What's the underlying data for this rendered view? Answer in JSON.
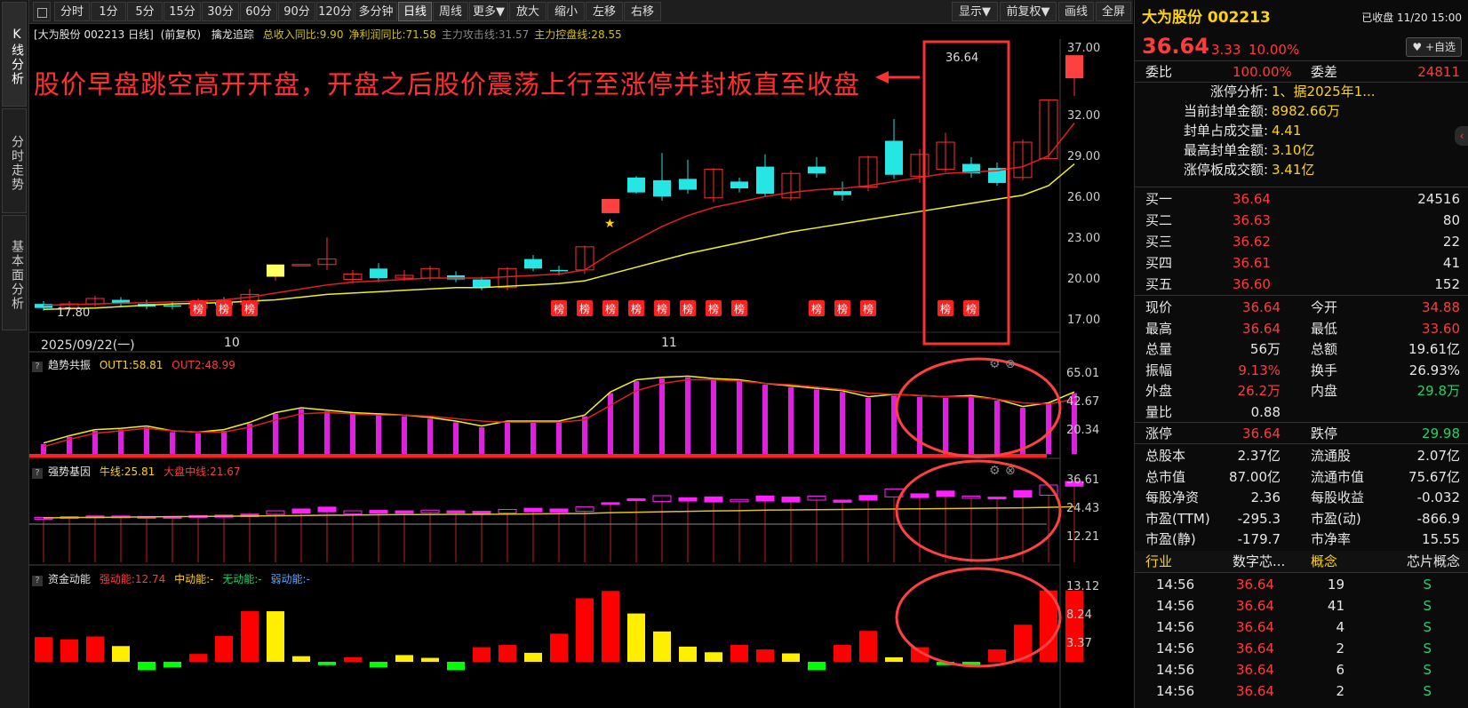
{
  "sidebar": {
    "tabs": [
      {
        "label": "K线分析",
        "active": true
      },
      {
        "label": "分时走势",
        "active": false
      },
      {
        "label": "基本面分析",
        "active": false
      }
    ]
  },
  "toolbar": {
    "lock_icon": "square-icon",
    "buttons": [
      "分时",
      "1分",
      "5分",
      "15分",
      "30分",
      "60分",
      "90分",
      "120分",
      "多分钟",
      "日线",
      "周线",
      "更多▼",
      "放大",
      "缩小",
      "左移",
      "右移"
    ],
    "active": "日线",
    "right_buttons": [
      "显示▼",
      "前复权▼",
      "画线",
      "全屏"
    ]
  },
  "chart_header": {
    "stock": "[大为股份 002213 日线]",
    "adjust": "(前复权)",
    "indicator": "擒龙追踪",
    "items": [
      {
        "text": "总收入同比:9.90",
        "color": "#d6c400"
      },
      {
        "text": "净利润同比:71.58",
        "color": "#d6c400"
      },
      {
        "text": "主力攻击线:31.57",
        "color": "#888888"
      },
      {
        "text": "主力控盘线:28.55",
        "color": "#d6c400"
      }
    ]
  },
  "annotation": "股价早盘跳空高开开盘，开盘之后股价震荡上行至涨停并封板直至收盘",
  "main_axis": [
    "37.00",
    "32.00",
    "29.00",
    "26.00",
    "23.00",
    "20.00",
    "17.00"
  ],
  "date_labels": {
    "start": "2025/09/22(一)",
    "m1": "10",
    "m2": "11"
  },
  "price_marks": {
    "high": "36.64",
    "low": "17.80"
  },
  "badge_text": "榜",
  "panels": {
    "p1": {
      "title": "趋势共振",
      "out1": "OUT1:58.81",
      "out2": "OUT2:48.99",
      "axis": [
        "65.01",
        "42.67",
        "20.34"
      ]
    },
    "p2": {
      "title": "强势基因",
      "l1": "牛线:25.81",
      "l2": "大盘中线:21.67",
      "axis": [
        "36.61",
        "24.43",
        "12.21"
      ]
    },
    "p3": {
      "title": "资金动能",
      "l1": "强动能:12.74",
      "l2": "中动能:-",
      "l3": "无动能:-",
      "l4": "弱动能:-",
      "axis": [
        "13.12",
        "8.24",
        "3.37"
      ]
    }
  },
  "chart_data": {
    "type": "candlestick",
    "candles": [
      [
        18.3,
        18.0,
        18.5,
        17.8
      ],
      [
        18.0,
        18.3,
        18.5,
        17.9
      ],
      [
        18.3,
        18.7,
        18.9,
        18.1
      ],
      [
        18.6,
        18.3,
        18.8,
        18.1
      ],
      [
        18.3,
        18.1,
        18.6,
        17.9
      ],
      [
        18.2,
        18.1,
        18.5,
        17.9
      ],
      [
        18.0,
        18.5,
        18.7,
        17.9
      ],
      [
        18.4,
        18.2,
        18.8,
        18.0
      ],
      [
        18.3,
        19.0,
        19.4,
        18.1
      ],
      [
        20.3,
        21.2,
        21.2,
        20.0
      ],
      [
        21.2,
        21.2,
        21.2,
        21.2
      ],
      [
        21.2,
        21.6,
        23.2,
        20.8
      ],
      [
        20.1,
        20.5,
        20.8,
        19.8
      ],
      [
        20.9,
        20.2,
        21.3,
        19.9
      ],
      [
        20.2,
        20.4,
        20.8,
        20.0
      ],
      [
        20.2,
        20.9,
        21.1,
        20.0
      ],
      [
        20.4,
        20.1,
        20.7,
        19.9
      ],
      [
        20.1,
        19.5,
        20.3,
        19.3
      ],
      [
        19.5,
        20.9,
        21.0,
        19.3
      ],
      [
        21.6,
        20.9,
        21.9,
        20.7
      ],
      [
        20.8,
        20.7,
        21.1,
        20.4
      ],
      [
        20.8,
        22.5,
        22.6,
        20.5
      ],
      [
        25.5,
        25.5,
        25.5,
        25.5
      ],
      [
        27.6,
        26.5,
        27.7,
        26.4
      ],
      [
        27.4,
        26.2,
        29.4,
        25.9
      ],
      [
        27.5,
        26.7,
        28.9,
        26.4
      ],
      [
        26.1,
        28.2,
        28.3,
        25.8
      ],
      [
        27.3,
        26.8,
        27.6,
        26.5
      ],
      [
        28.4,
        26.4,
        29.3,
        26.2
      ],
      [
        26.1,
        27.9,
        28.1,
        25.9
      ],
      [
        28.4,
        27.9,
        29.1,
        27.6
      ],
      [
        26.6,
        26.3,
        27.3,
        25.9
      ],
      [
        26.9,
        29.1,
        29.2,
        26.6
      ],
      [
        30.3,
        27.8,
        31.9,
        27.5
      ],
      [
        27.7,
        29.3,
        29.7,
        27.2
      ],
      [
        28.2,
        30.2,
        30.9,
        28.0
      ],
      [
        28.6,
        27.9,
        29.1,
        27.6
      ],
      [
        28.3,
        27.2,
        28.7,
        27.0
      ],
      [
        27.6,
        30.2,
        30.4,
        27.4
      ],
      [
        29.0,
        33.3,
        33.3,
        29.0
      ],
      [
        34.9,
        36.6,
        36.6,
        33.6
      ]
    ],
    "ma_red": [
      18.2,
      18.25,
      18.3,
      18.35,
      18.4,
      18.45,
      18.5,
      18.6,
      18.8,
      19.1,
      19.4,
      19.7,
      19.9,
      20.0,
      20.1,
      20.2,
      20.2,
      20.2,
      20.3,
      20.4,
      20.5,
      20.8,
      22.0,
      23.0,
      24.0,
      24.8,
      25.4,
      25.8,
      26.2,
      26.5,
      26.7,
      26.8,
      27.0,
      27.3,
      27.6,
      27.9,
      28.0,
      28.1,
      28.4,
      29.2,
      31.6
    ],
    "ma_yellow": [
      17.9,
      17.95,
      18.0,
      18.1,
      18.2,
      18.3,
      18.35,
      18.4,
      18.5,
      18.6,
      18.8,
      19.0,
      19.1,
      19.2,
      19.3,
      19.4,
      19.5,
      19.5,
      19.6,
      19.7,
      19.8,
      20.0,
      20.5,
      21.0,
      21.5,
      22.0,
      22.4,
      22.8,
      23.2,
      23.6,
      23.9,
      24.2,
      24.5,
      24.8,
      25.1,
      25.4,
      25.7,
      26.0,
      26.3,
      27.0,
      28.6
    ],
    "badges": [
      6,
      7,
      8,
      20,
      21,
      22,
      23,
      24,
      25,
      26,
      27,
      30,
      31,
      32,
      35,
      36
    ],
    "p1_values": [
      8,
      14,
      19,
      20,
      22,
      18,
      17,
      19,
      25,
      33,
      37,
      35,
      33,
      32,
      31,
      29,
      26,
      22,
      26,
      26,
      26,
      31,
      50,
      60,
      62,
      63,
      61,
      60,
      57,
      55,
      53,
      51,
      46,
      48,
      47,
      46,
      47,
      44,
      38,
      41,
      50,
      58
    ],
    "p1_red": [
      6,
      12,
      17,
      19,
      21,
      19,
      18,
      18,
      22,
      28,
      33,
      34,
      33,
      32,
      32,
      31,
      29,
      27,
      26,
      26,
      26,
      28,
      40,
      52,
      58,
      61,
      61,
      60,
      58,
      57,
      55,
      53,
      50,
      49,
      48,
      47,
      47,
      45,
      42,
      41,
      45,
      49
    ],
    "p2_values": [
      [
        20.5,
        21.2
      ],
      [
        20.8,
        21.5
      ],
      [
        21.0,
        21.8
      ],
      [
        21.1,
        21.8
      ],
      [
        21.0,
        21.6
      ],
      [
        20.9,
        21.6
      ],
      [
        21.2,
        22.0
      ],
      [
        21.3,
        22.2
      ],
      [
        21.5,
        22.6
      ],
      [
        22.5,
        24.0
      ],
      [
        23.0,
        24.8
      ],
      [
        23.6,
        25.6
      ],
      [
        22.8,
        24.0
      ],
      [
        23.0,
        24.2
      ],
      [
        23.0,
        24.0
      ],
      [
        23.2,
        24.3
      ],
      [
        23.1,
        24.0
      ],
      [
        22.6,
        23.8
      ],
      [
        23.0,
        24.6
      ],
      [
        23.6,
        25.1
      ],
      [
        23.5,
        24.8
      ],
      [
        23.8,
        25.7
      ],
      [
        27.5,
        27.5
      ],
      [
        28.4,
        29.2
      ],
      [
        28.0,
        30.5
      ],
      [
        28.2,
        29.6
      ],
      [
        27.8,
        30.0
      ],
      [
        27.9,
        28.9
      ],
      [
        28.2,
        30.4
      ],
      [
        27.8,
        29.9
      ],
      [
        28.6,
        30.3
      ],
      [
        27.7,
        28.6
      ],
      [
        28.6,
        30.6
      ],
      [
        30.0,
        33.4
      ],
      [
        29.7,
        31.3
      ],
      [
        30.2,
        32.5
      ],
      [
        29.4,
        30.3
      ],
      [
        29.2,
        29.9
      ],
      [
        29.9,
        32.7
      ],
      [
        30.7,
        35.1
      ],
      [
        34.6,
        36.6
      ]
    ],
    "p2_line": [
      21.0,
      21.1,
      21.2,
      21.3,
      21.4,
      21.5,
      21.6,
      21.7,
      21.8,
      21.9,
      22.0,
      22.1,
      22.2,
      22.3,
      22.4,
      22.4,
      22.5,
      22.5,
      22.6,
      22.7,
      22.8,
      22.9,
      23.2,
      23.4,
      23.6,
      23.8,
      24.0,
      24.1,
      24.3,
      24.4,
      24.5,
      24.6,
      24.7,
      24.8,
      24.9,
      25.0,
      25.1,
      25.2,
      25.3,
      25.5,
      25.8
    ],
    "p3_values": [
      [
        4.4,
        "#ff0000"
      ],
      [
        4.0,
        "#ff0000"
      ],
      [
        4.5,
        "#ff0000"
      ],
      [
        2.8,
        "#ffee00"
      ],
      [
        -1.5,
        "#00ff00"
      ],
      [
        -1.0,
        "#00ff00"
      ],
      [
        1.4,
        "#ff0000"
      ],
      [
        4.6,
        "#ff0000"
      ],
      [
        9.0,
        "#ff0000"
      ],
      [
        9.0,
        "#ffee00"
      ],
      [
        1.0,
        "#ffee00"
      ],
      [
        -0.6,
        "#00ff00"
      ],
      [
        0.8,
        "#ff0000"
      ],
      [
        -1.0,
        "#00ff00"
      ],
      [
        1.2,
        "#ffee00"
      ],
      [
        0.7,
        "#ffee00"
      ],
      [
        -1.5,
        "#00ff00"
      ],
      [
        2.6,
        "#ff0000"
      ],
      [
        3.0,
        "#ff0000"
      ],
      [
        1.6,
        "#ffee00"
      ],
      [
        5.0,
        "#ff0000"
      ],
      [
        11.3,
        "#ff0000"
      ],
      [
        12.6,
        "#ff0000"
      ],
      [
        8.6,
        "#ffee00"
      ],
      [
        5.4,
        "#ffee00"
      ],
      [
        2.7,
        "#ffee00"
      ],
      [
        1.7,
        "#ffee00"
      ],
      [
        3.0,
        "#ff0000"
      ],
      [
        2.2,
        "#ff0000"
      ],
      [
        1.5,
        "#ffee00"
      ],
      [
        -1.5,
        "#00ff00"
      ],
      [
        3.0,
        "#ff0000"
      ],
      [
        5.5,
        "#ff0000"
      ],
      [
        0.8,
        "#ffee00"
      ],
      [
        2.6,
        "#ff0000"
      ],
      [
        -0.6,
        "#00ff00"
      ],
      [
        -0.8,
        "#00ff00"
      ],
      [
        2.2,
        "#ff0000"
      ],
      [
        6.6,
        "#ff0000"
      ],
      [
        12.7,
        "#ff0000"
      ],
      [
        12.7,
        "#ff0000"
      ]
    ]
  },
  "right_panel": {
    "name": "大为股份 002213",
    "status": "已收盘 11/20 15:00",
    "price": "36.64",
    "change": "3.33",
    "pct": "10.00%",
    "fav_label": "+自选",
    "weibi_label": "委比",
    "weibi": "100.00%",
    "weicha_label": "委差",
    "weicha": "24811",
    "limit_analysis": [
      {
        "k": "涨停分析:",
        "v": "1、据2025年1..."
      },
      {
        "k": "当前封单金额:",
        "v": "8982.66万"
      },
      {
        "k": "封单占成交量:",
        "v": "4.41"
      },
      {
        "k": "最高封单金额:",
        "v": "3.10亿"
      },
      {
        "k": "涨停板成交额:",
        "v": "3.41亿"
      }
    ],
    "bids": [
      {
        "k": "买一",
        "p": "36.64",
        "v": "24516"
      },
      {
        "k": "买二",
        "p": "36.63",
        "v": "80"
      },
      {
        "k": "买三",
        "p": "36.62",
        "v": "22"
      },
      {
        "k": "买四",
        "p": "36.61",
        "v": "41"
      },
      {
        "k": "买五",
        "p": "36.60",
        "v": "152"
      }
    ],
    "quotes": [
      [
        {
          "k": "现价",
          "v": "36.64",
          "c": "red"
        },
        {
          "k": "今开",
          "v": "34.88",
          "c": "red"
        }
      ],
      [
        {
          "k": "最高",
          "v": "36.64",
          "c": "red"
        },
        {
          "k": "最低",
          "v": "33.60",
          "c": "red"
        }
      ],
      [
        {
          "k": "总量",
          "v": "56万",
          "c": "white"
        },
        {
          "k": "总额",
          "v": "19.61亿",
          "c": "white"
        }
      ],
      [
        {
          "k": "振幅",
          "v": "9.13%",
          "c": "red"
        },
        {
          "k": "换手",
          "v": "26.93%",
          "c": "white"
        }
      ],
      [
        {
          "k": "外盘",
          "v": "26.2万",
          "c": "red"
        },
        {
          "k": "内盘",
          "v": "29.8万",
          "c": "green"
        }
      ],
      [
        {
          "k": "量比",
          "v": "0.88",
          "c": "white"
        },
        {
          "k": "",
          "v": "",
          "c": "white"
        }
      ]
    ],
    "limits": [
      {
        "k": "涨停",
        "v": "36.64",
        "c": "red"
      },
      {
        "k": "跌停",
        "v": "29.98",
        "c": "green"
      }
    ],
    "fundamentals": [
      [
        {
          "k": "总股本",
          "v": "2.37亿"
        },
        {
          "k": "流通股",
          "v": "2.07亿"
        }
      ],
      [
        {
          "k": "总市值",
          "v": "87.00亿"
        },
        {
          "k": "流通市值",
          "v": "75.67亿"
        }
      ],
      [
        {
          "k": "每股净资",
          "v": "2.36"
        },
        {
          "k": "每股收益",
          "v": "-0.032"
        }
      ],
      [
        {
          "k": "市盈(TTM)",
          "v": "-295.3"
        },
        {
          "k": "市盈(动)",
          "v": "-866.9"
        }
      ],
      [
        {
          "k": "市盈(静)",
          "v": "-179.7"
        },
        {
          "k": "市净率",
          "v": "15.55"
        }
      ]
    ],
    "industry": {
      "k": "行业",
      "v": "数字芯...",
      "k2": "概念",
      "v2": "芯片概念"
    },
    "ticks": [
      {
        "t": "14:56",
        "p": "36.64",
        "v": "19",
        "s": "S"
      },
      {
        "t": "14:56",
        "p": "36.64",
        "v": "41",
        "s": "S"
      },
      {
        "t": "14:56",
        "p": "36.64",
        "v": "4",
        "s": "S"
      },
      {
        "t": "14:56",
        "p": "36.64",
        "v": "2",
        "s": "S"
      },
      {
        "t": "14:56",
        "p": "36.64",
        "v": "6",
        "s": "S"
      },
      {
        "t": "14:56",
        "p": "36.64",
        "v": "2",
        "s": "S"
      }
    ],
    "collapse_icon": "chevron-left-icon"
  }
}
